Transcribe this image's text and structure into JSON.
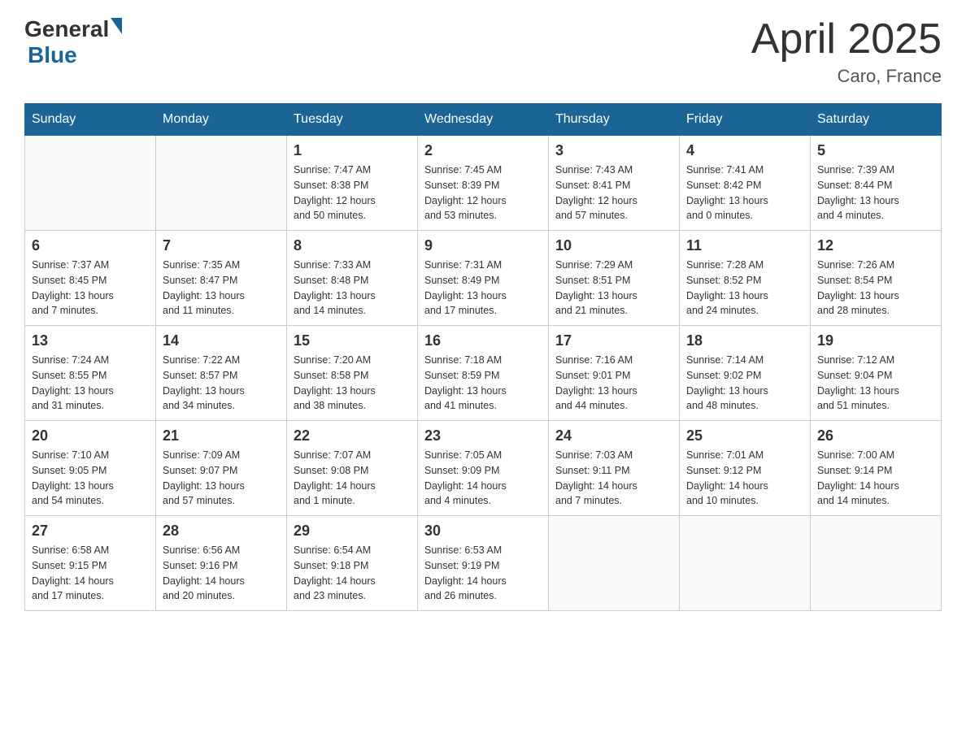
{
  "header": {
    "logo_general": "General",
    "logo_blue": "Blue",
    "month": "April 2025",
    "location": "Caro, France"
  },
  "days_of_week": [
    "Sunday",
    "Monday",
    "Tuesday",
    "Wednesday",
    "Thursday",
    "Friday",
    "Saturday"
  ],
  "weeks": [
    [
      {
        "day": "",
        "info": ""
      },
      {
        "day": "",
        "info": ""
      },
      {
        "day": "1",
        "info": "Sunrise: 7:47 AM\nSunset: 8:38 PM\nDaylight: 12 hours\nand 50 minutes."
      },
      {
        "day": "2",
        "info": "Sunrise: 7:45 AM\nSunset: 8:39 PM\nDaylight: 12 hours\nand 53 minutes."
      },
      {
        "day": "3",
        "info": "Sunrise: 7:43 AM\nSunset: 8:41 PM\nDaylight: 12 hours\nand 57 minutes."
      },
      {
        "day": "4",
        "info": "Sunrise: 7:41 AM\nSunset: 8:42 PM\nDaylight: 13 hours\nand 0 minutes."
      },
      {
        "day": "5",
        "info": "Sunrise: 7:39 AM\nSunset: 8:44 PM\nDaylight: 13 hours\nand 4 minutes."
      }
    ],
    [
      {
        "day": "6",
        "info": "Sunrise: 7:37 AM\nSunset: 8:45 PM\nDaylight: 13 hours\nand 7 minutes."
      },
      {
        "day": "7",
        "info": "Sunrise: 7:35 AM\nSunset: 8:47 PM\nDaylight: 13 hours\nand 11 minutes."
      },
      {
        "day": "8",
        "info": "Sunrise: 7:33 AM\nSunset: 8:48 PM\nDaylight: 13 hours\nand 14 minutes."
      },
      {
        "day": "9",
        "info": "Sunrise: 7:31 AM\nSunset: 8:49 PM\nDaylight: 13 hours\nand 17 minutes."
      },
      {
        "day": "10",
        "info": "Sunrise: 7:29 AM\nSunset: 8:51 PM\nDaylight: 13 hours\nand 21 minutes."
      },
      {
        "day": "11",
        "info": "Sunrise: 7:28 AM\nSunset: 8:52 PM\nDaylight: 13 hours\nand 24 minutes."
      },
      {
        "day": "12",
        "info": "Sunrise: 7:26 AM\nSunset: 8:54 PM\nDaylight: 13 hours\nand 28 minutes."
      }
    ],
    [
      {
        "day": "13",
        "info": "Sunrise: 7:24 AM\nSunset: 8:55 PM\nDaylight: 13 hours\nand 31 minutes."
      },
      {
        "day": "14",
        "info": "Sunrise: 7:22 AM\nSunset: 8:57 PM\nDaylight: 13 hours\nand 34 minutes."
      },
      {
        "day": "15",
        "info": "Sunrise: 7:20 AM\nSunset: 8:58 PM\nDaylight: 13 hours\nand 38 minutes."
      },
      {
        "day": "16",
        "info": "Sunrise: 7:18 AM\nSunset: 8:59 PM\nDaylight: 13 hours\nand 41 minutes."
      },
      {
        "day": "17",
        "info": "Sunrise: 7:16 AM\nSunset: 9:01 PM\nDaylight: 13 hours\nand 44 minutes."
      },
      {
        "day": "18",
        "info": "Sunrise: 7:14 AM\nSunset: 9:02 PM\nDaylight: 13 hours\nand 48 minutes."
      },
      {
        "day": "19",
        "info": "Sunrise: 7:12 AM\nSunset: 9:04 PM\nDaylight: 13 hours\nand 51 minutes."
      }
    ],
    [
      {
        "day": "20",
        "info": "Sunrise: 7:10 AM\nSunset: 9:05 PM\nDaylight: 13 hours\nand 54 minutes."
      },
      {
        "day": "21",
        "info": "Sunrise: 7:09 AM\nSunset: 9:07 PM\nDaylight: 13 hours\nand 57 minutes."
      },
      {
        "day": "22",
        "info": "Sunrise: 7:07 AM\nSunset: 9:08 PM\nDaylight: 14 hours\nand 1 minute."
      },
      {
        "day": "23",
        "info": "Sunrise: 7:05 AM\nSunset: 9:09 PM\nDaylight: 14 hours\nand 4 minutes."
      },
      {
        "day": "24",
        "info": "Sunrise: 7:03 AM\nSunset: 9:11 PM\nDaylight: 14 hours\nand 7 minutes."
      },
      {
        "day": "25",
        "info": "Sunrise: 7:01 AM\nSunset: 9:12 PM\nDaylight: 14 hours\nand 10 minutes."
      },
      {
        "day": "26",
        "info": "Sunrise: 7:00 AM\nSunset: 9:14 PM\nDaylight: 14 hours\nand 14 minutes."
      }
    ],
    [
      {
        "day": "27",
        "info": "Sunrise: 6:58 AM\nSunset: 9:15 PM\nDaylight: 14 hours\nand 17 minutes."
      },
      {
        "day": "28",
        "info": "Sunrise: 6:56 AM\nSunset: 9:16 PM\nDaylight: 14 hours\nand 20 minutes."
      },
      {
        "day": "29",
        "info": "Sunrise: 6:54 AM\nSunset: 9:18 PM\nDaylight: 14 hours\nand 23 minutes."
      },
      {
        "day": "30",
        "info": "Sunrise: 6:53 AM\nSunset: 9:19 PM\nDaylight: 14 hours\nand 26 minutes."
      },
      {
        "day": "",
        "info": ""
      },
      {
        "day": "",
        "info": ""
      },
      {
        "day": "",
        "info": ""
      }
    ]
  ]
}
